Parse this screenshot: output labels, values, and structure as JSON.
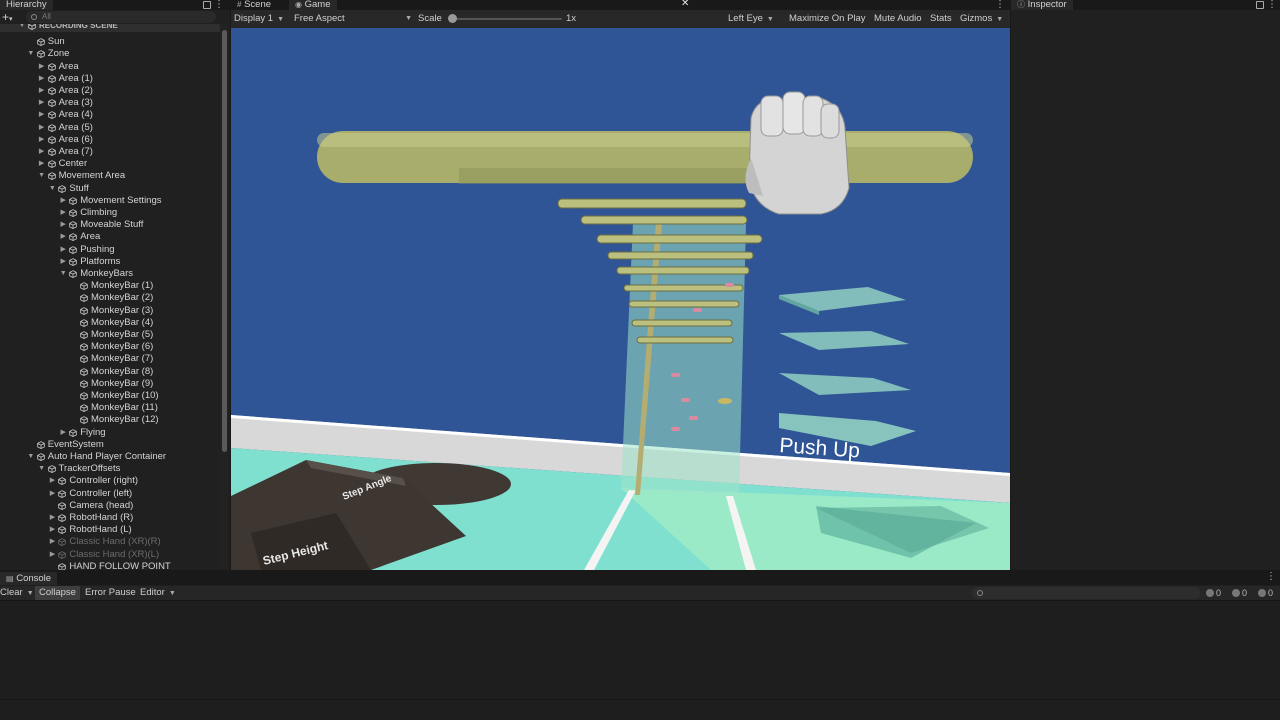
{
  "hierarchy": {
    "tab": "Hierarchy",
    "search_placeholder": "All",
    "items": [
      {
        "label": "RECORDING SCENE",
        "depth": 0,
        "expand": "open",
        "header": true
      },
      {
        "label": "Sun",
        "depth": 1,
        "expand": "none"
      },
      {
        "label": "Zone",
        "depth": 1,
        "expand": "open"
      },
      {
        "label": "Area",
        "depth": 2,
        "expand": "closed"
      },
      {
        "label": "Area (1)",
        "depth": 2,
        "expand": "closed"
      },
      {
        "label": "Area (2)",
        "depth": 2,
        "expand": "closed"
      },
      {
        "label": "Area (3)",
        "depth": 2,
        "expand": "closed"
      },
      {
        "label": "Area (4)",
        "depth": 2,
        "expand": "closed"
      },
      {
        "label": "Area (5)",
        "depth": 2,
        "expand": "closed"
      },
      {
        "label": "Area (6)",
        "depth": 2,
        "expand": "closed"
      },
      {
        "label": "Area (7)",
        "depth": 2,
        "expand": "closed"
      },
      {
        "label": "Center",
        "depth": 2,
        "expand": "closed"
      },
      {
        "label": "Movement Area",
        "depth": 2,
        "expand": "open"
      },
      {
        "label": "Stuff",
        "depth": 3,
        "expand": "open"
      },
      {
        "label": "Movement Settings",
        "depth": 4,
        "expand": "closed"
      },
      {
        "label": "Climbing",
        "depth": 4,
        "expand": "closed"
      },
      {
        "label": "Moveable Stuff",
        "depth": 4,
        "expand": "closed"
      },
      {
        "label": "Area",
        "depth": 4,
        "expand": "closed"
      },
      {
        "label": "Pushing",
        "depth": 4,
        "expand": "closed"
      },
      {
        "label": "Platforms",
        "depth": 4,
        "expand": "closed"
      },
      {
        "label": "MonkeyBars",
        "depth": 4,
        "expand": "open"
      },
      {
        "label": "MonkeyBar (1)",
        "depth": 5,
        "expand": "none"
      },
      {
        "label": "MonkeyBar (2)",
        "depth": 5,
        "expand": "none"
      },
      {
        "label": "MonkeyBar (3)",
        "depth": 5,
        "expand": "none"
      },
      {
        "label": "MonkeyBar (4)",
        "depth": 5,
        "expand": "none"
      },
      {
        "label": "MonkeyBar (5)",
        "depth": 5,
        "expand": "none"
      },
      {
        "label": "MonkeyBar (6)",
        "depth": 5,
        "expand": "none"
      },
      {
        "label": "MonkeyBar (7)",
        "depth": 5,
        "expand": "none"
      },
      {
        "label": "MonkeyBar (8)",
        "depth": 5,
        "expand": "none"
      },
      {
        "label": "MonkeyBar (9)",
        "depth": 5,
        "expand": "none"
      },
      {
        "label": "MonkeyBar (10)",
        "depth": 5,
        "expand": "none"
      },
      {
        "label": "MonkeyBar (11)",
        "depth": 5,
        "expand": "none"
      },
      {
        "label": "MonkeyBar (12)",
        "depth": 5,
        "expand": "none"
      },
      {
        "label": "Flying",
        "depth": 4,
        "expand": "closed"
      },
      {
        "label": "EventSystem",
        "depth": 1,
        "expand": "none"
      },
      {
        "label": "Auto Hand Player Container",
        "depth": 1,
        "expand": "open"
      },
      {
        "label": "TrackerOffsets",
        "depth": 2,
        "expand": "open"
      },
      {
        "label": "Controller (right)",
        "depth": 3,
        "expand": "closed"
      },
      {
        "label": "Controller (left)",
        "depth": 3,
        "expand": "closed"
      },
      {
        "label": "Camera (head)",
        "depth": 3,
        "expand": "none"
      },
      {
        "label": "RobotHand (R)",
        "depth": 3,
        "expand": "closed"
      },
      {
        "label": "RobotHand (L)",
        "depth": 3,
        "expand": "closed"
      },
      {
        "label": "Classic Hand (XR)(R)",
        "depth": 3,
        "expand": "closed",
        "disabled": true
      },
      {
        "label": "Classic Hand (XR)(L)",
        "depth": 3,
        "expand": "closed",
        "disabled": true
      },
      {
        "label": "HAND FOLLOW POINT",
        "depth": 3,
        "expand": "none"
      }
    ]
  },
  "tabs": {
    "scene": "Scene",
    "game": "Game",
    "inspector": "Inspector",
    "console": "Console"
  },
  "game_toolbar": {
    "display": "Display 1",
    "aspect": "Free Aspect",
    "scale_label": "Scale",
    "scale_value": "1x",
    "scale_level": 0,
    "eye": "Left Eye",
    "maximize": "Maximize On Play",
    "mute": "Mute Audio",
    "stats": "Stats",
    "gizmos": "Gizmos"
  },
  "viewport": {
    "sky_color": "#2f5596",
    "floor_color": "#7fe0d0",
    "bar_color": "#a8ad6c",
    "label_push_up": "Push Up",
    "label_step_angle": "Step Angle",
    "label_step_height": "Step Height"
  },
  "console": {
    "clear": "Clear",
    "collapse": "Collapse",
    "error_pause": "Error Pause",
    "editor": "Editor",
    "log_count": "0",
    "warning_count": "0",
    "error_count": "0"
  }
}
